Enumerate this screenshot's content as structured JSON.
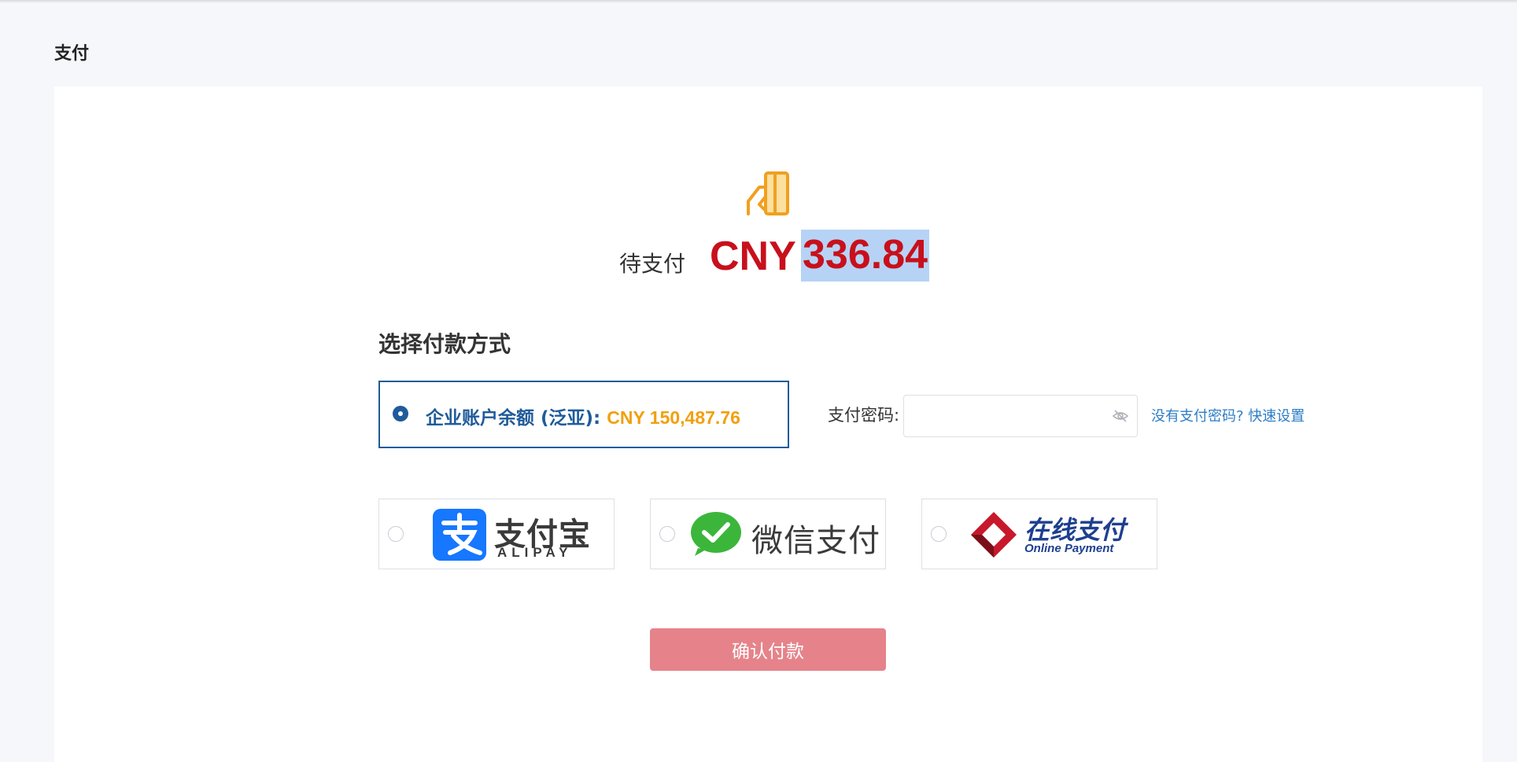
{
  "page": {
    "title": "支付"
  },
  "due": {
    "label": "待支付",
    "currency": "CNY",
    "amount": "336.84"
  },
  "payment": {
    "section_title": "选择付款方式",
    "balance": {
      "label": "企业账户余额 (泛亚):",
      "amount": "CNY 150,487.76",
      "selected": true
    },
    "password": {
      "label": "支付密码:",
      "value": "",
      "placeholder": "",
      "setup_link": "没有支付密码? 快速设置"
    },
    "methods": [
      {
        "id": "alipay",
        "name_cn": "支付宝",
        "name_en": "ALIPAY",
        "selected": false
      },
      {
        "id": "wechat",
        "name_cn": "微信支付",
        "selected": false
      },
      {
        "id": "online",
        "name_cn": "在线支付",
        "name_en": "Online Payment",
        "selected": false
      }
    ],
    "confirm_label": "确认付款"
  },
  "colors": {
    "amount_red": "#c8101c",
    "brand_blue": "#1f5b9a",
    "balance_orange": "#f0a010",
    "link_blue": "#2d7dc6",
    "confirm_button": "#e6838a",
    "alipay_blue": "#1677ff",
    "wechat_green": "#3bb63b",
    "online_red": "#c7192b"
  },
  "icons": [
    "card-in-hand-icon",
    "eye-off-icon",
    "alipay-logo-icon",
    "wechat-logo-icon",
    "online-payment-logo-icon"
  ]
}
